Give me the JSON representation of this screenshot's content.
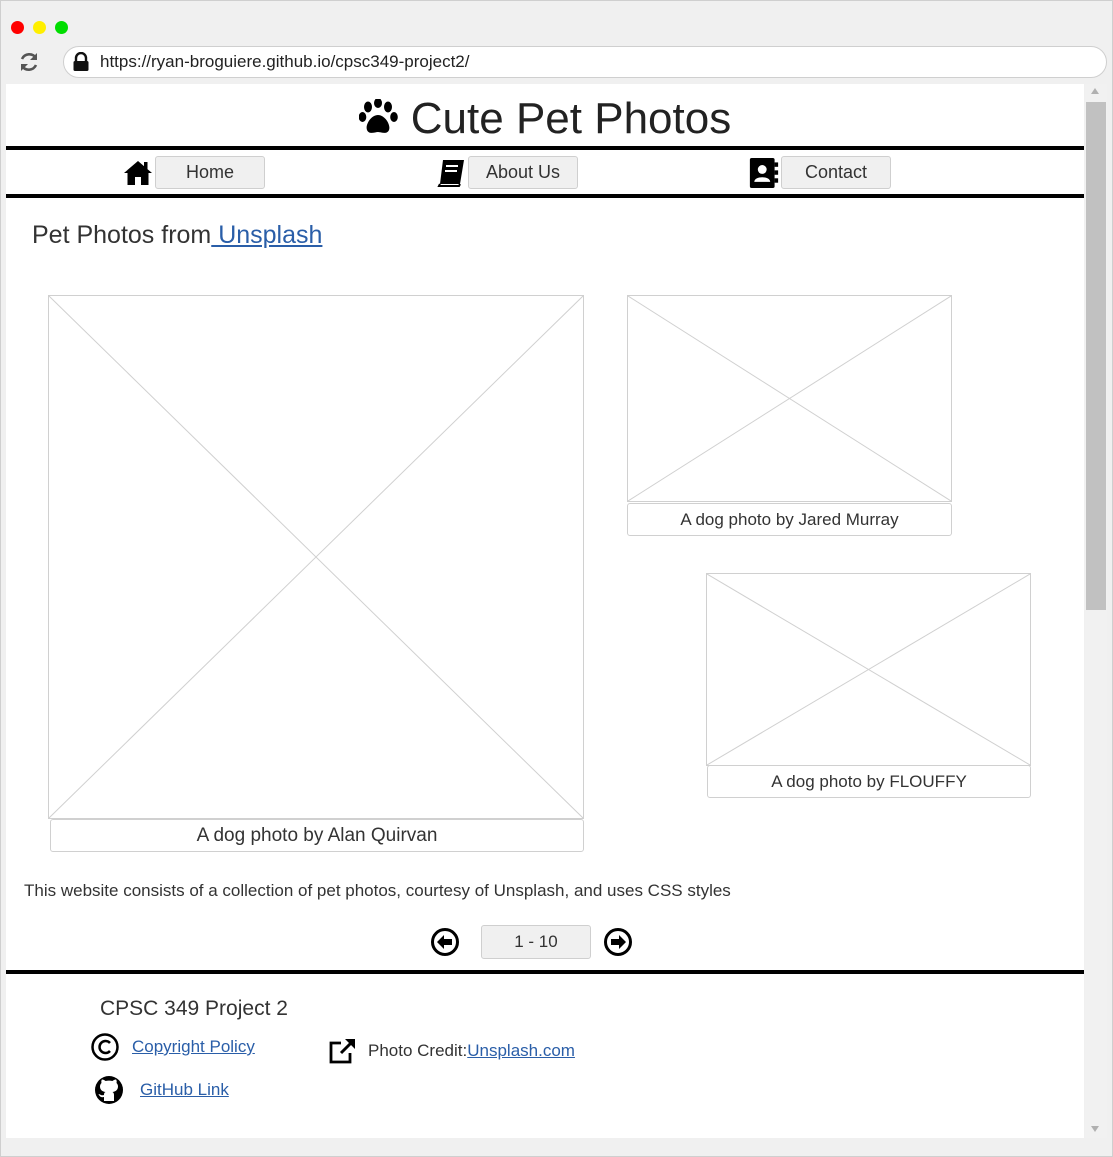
{
  "browser": {
    "url": "https://ryan-broguiere.github.io/cpsc349-project2/"
  },
  "site": {
    "title": "Cute Pet Photos"
  },
  "nav": {
    "items": [
      {
        "label": "Home",
        "icon": "home-icon"
      },
      {
        "label": "About Us",
        "icon": "book-icon"
      },
      {
        "label": "Contact",
        "icon": "address-book-icon"
      }
    ]
  },
  "main": {
    "heading_prefix": "Pet Photos from",
    "heading_link": " Unsplash ",
    "photos": [
      {
        "caption": "A dog photo by Alan Quirvan"
      },
      {
        "caption": "A dog photo by Jared Murray"
      },
      {
        "caption": "A dog photo by FLOUFFY"
      }
    ],
    "description": "This website consists of a collection of pet photos, courtesy of Unsplash, and uses CSS styles"
  },
  "pager": {
    "range": "1 - 10"
  },
  "footer": {
    "title": "CPSC 349 Project 2",
    "copyright_link": " Copyright Policy ",
    "photo_credit_label": "Photo Credit: ",
    "photo_credit_link": " Unsplash.com ",
    "github_link": " GitHub Link "
  },
  "colors": {
    "link": "#2a5ea8",
    "rule": "#000000",
    "button_bg": "#f0f0f0"
  }
}
